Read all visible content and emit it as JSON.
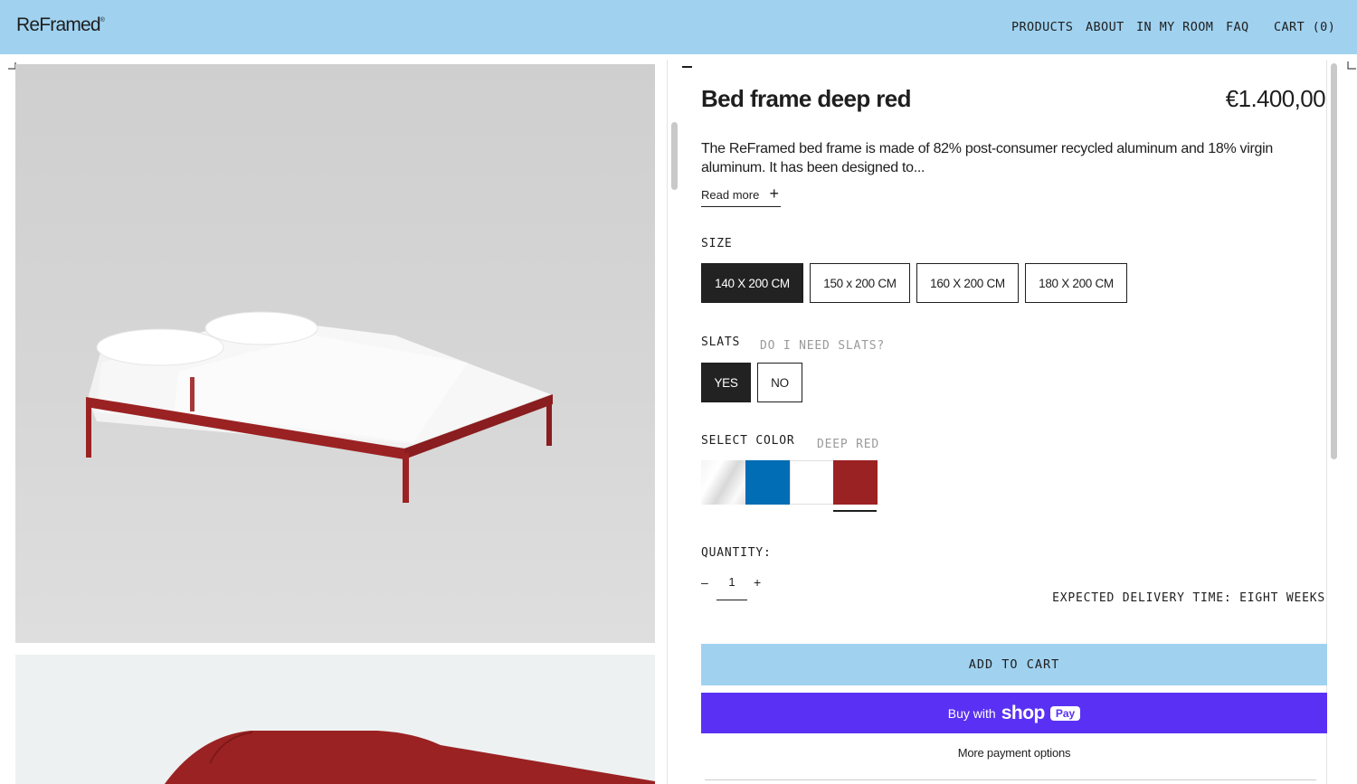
{
  "brand": {
    "name": "ReFramed",
    "mark": "®"
  },
  "nav": {
    "products": "PRODUCTS",
    "about": "ABOUT",
    "in_my_room": "IN MY ROOM",
    "faq": "FAQ",
    "cart": "CART (0)"
  },
  "product": {
    "title": "Bed frame deep red",
    "price": "€1.400,00",
    "description": "The ReFramed bed frame is made of 82% post-consumer recycled aluminum and 18% virgin aluminum. It has been designed to...",
    "read_more": "Read more",
    "read_more_icon": "plus-icon"
  },
  "size": {
    "label": "SIZE",
    "options": [
      "140 X 200 CM",
      "150 x 200 CM",
      "160 X 200 CM",
      "180 X 200 CM"
    ],
    "selected": "140 X 200 CM"
  },
  "slats": {
    "label": "SLATS",
    "help": "DO I NEED SLATS?",
    "options": [
      "YES",
      "NO"
    ],
    "selected": "YES"
  },
  "color": {
    "label": "SELECT COLOR",
    "selected_name": "DEEP RED",
    "swatches": [
      {
        "name": "aluminum",
        "color": "#e8e8e8"
      },
      {
        "name": "blue",
        "color": "#006db4"
      },
      {
        "name": "white",
        "color": "#ffffff"
      },
      {
        "name": "deep-red",
        "color": "#9b2223"
      }
    ]
  },
  "quantity": {
    "label": "QUANTITY:",
    "minus": "–",
    "value": "1",
    "plus": "+"
  },
  "delivery": "EXPECTED DELIVERY TIME: EIGHT WEEKS",
  "buttons": {
    "add_to_cart": "ADD TO CART",
    "shop_pay_prefix": "Buy with",
    "shop_pay_brand": "shop",
    "shop_pay_badge": "Pay",
    "more_payment": "More payment options"
  },
  "colors": {
    "header_bg": "#a0d2f0",
    "shop_pay": "#5a31f4",
    "selected_option": "#222222",
    "frame_red": "#9b2223"
  }
}
